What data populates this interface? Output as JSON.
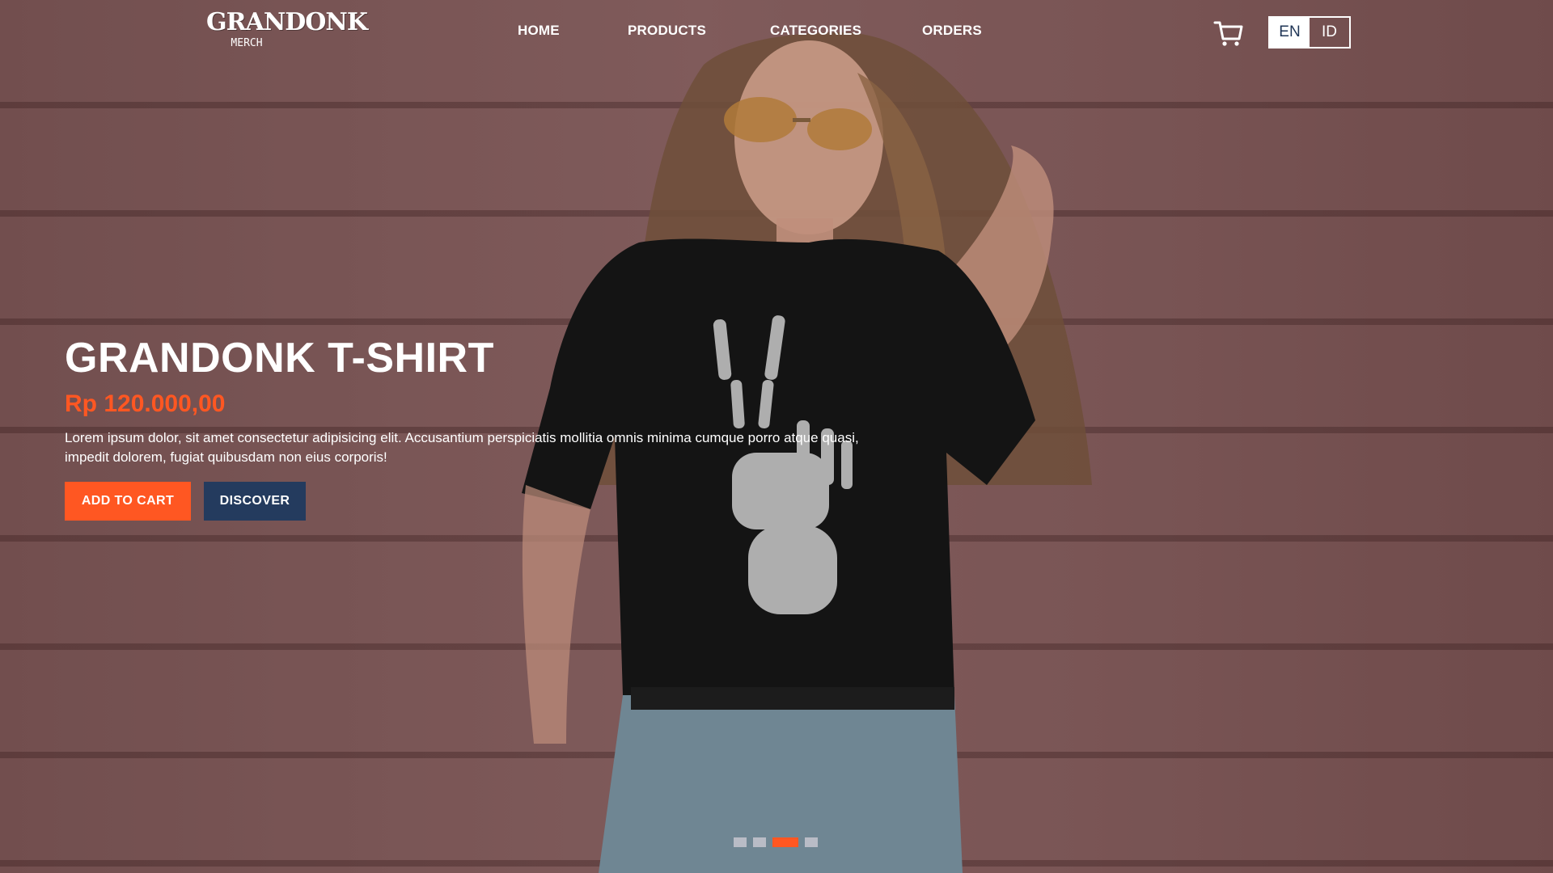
{
  "brand": {
    "logo_text": "GRANDONK",
    "logo_sub": "MERCH"
  },
  "nav": {
    "items": [
      {
        "label": "HOME"
      },
      {
        "label": "PRODUCTS"
      },
      {
        "label": "CATEGORIES"
      },
      {
        "label": "ORDERS"
      }
    ]
  },
  "header": {
    "cart_icon": "cart-icon",
    "languages": [
      {
        "code": "EN",
        "active": true
      },
      {
        "code": "ID",
        "active": false
      }
    ]
  },
  "hero": {
    "title": "GRANDONK T-SHIRT",
    "price": "Rp 120.000,00",
    "description": "Lorem ipsum dolor, sit amet consectetur adipisicing elit. Accusantium perspiciatis mollitia omnis minima cumque porro atque quasi, impedit dolorem, fugiat quibusdam non eius corporis!",
    "add_to_cart_label": "ADD TO CART",
    "discover_label": "DISCOVER"
  },
  "carousel": {
    "slide_count": 4,
    "active_index": 2
  },
  "colors": {
    "accent": "#ff5722",
    "secondary": "#243b5e",
    "dot_inactive": "#b9bcc6"
  }
}
